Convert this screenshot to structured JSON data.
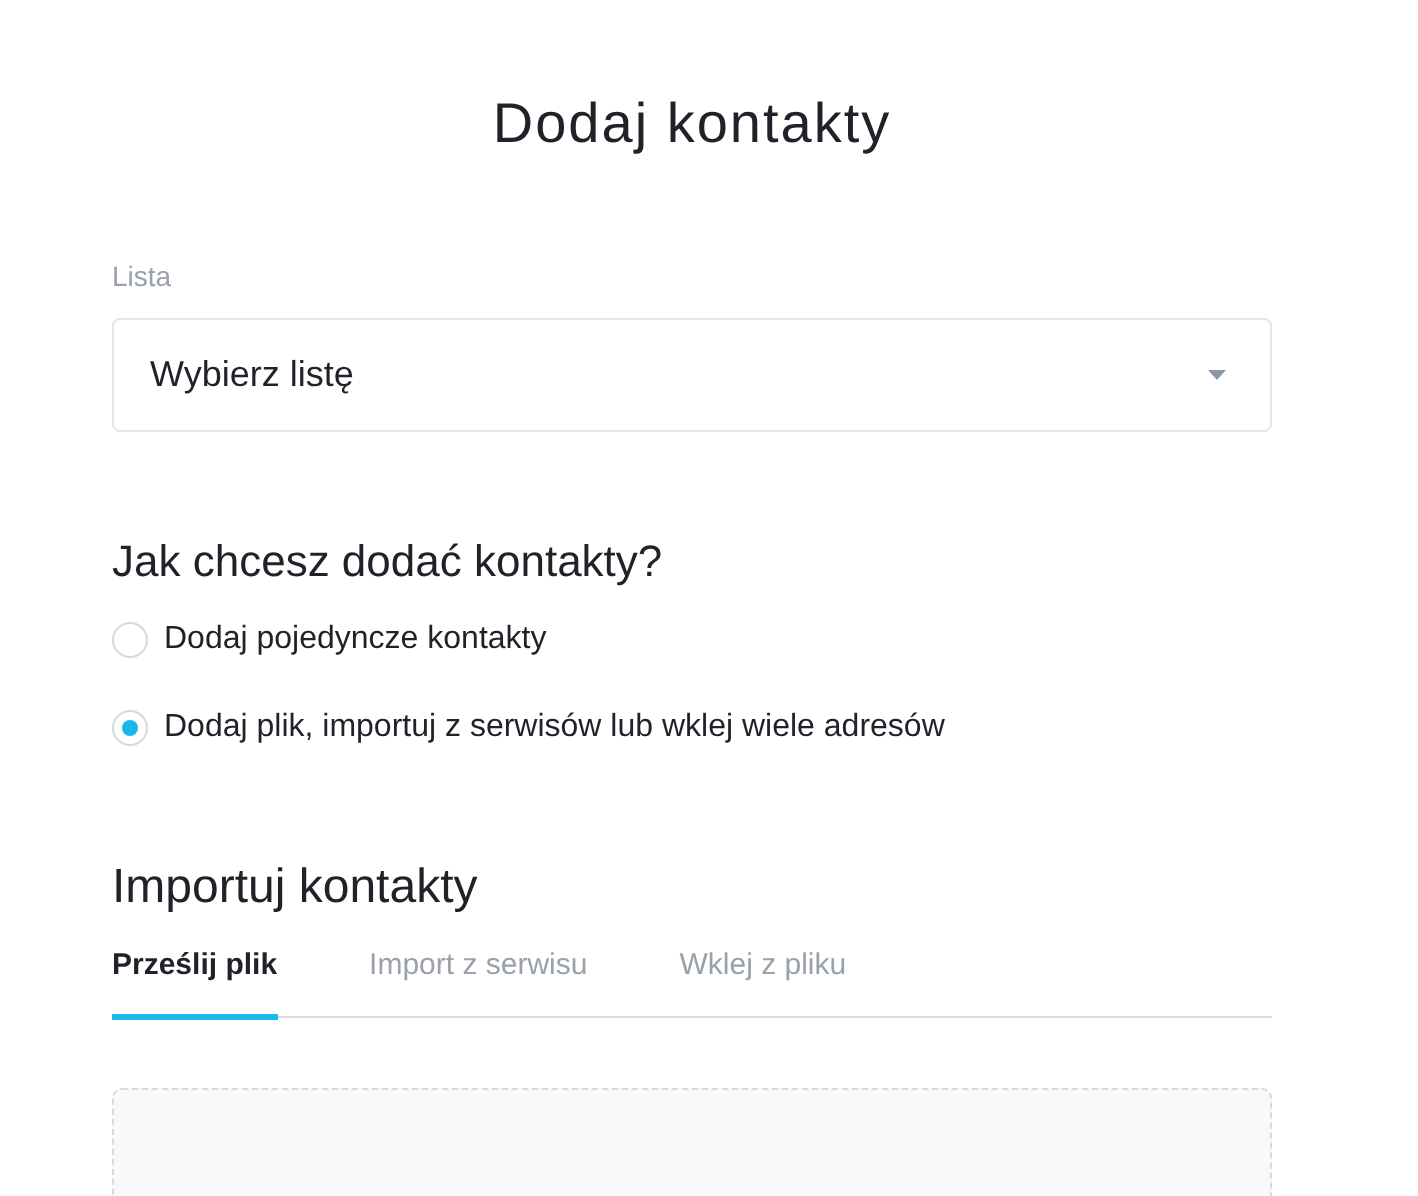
{
  "title": "Dodaj kontakty",
  "list_field": {
    "label": "Lista",
    "placeholder": "Wybierz listę"
  },
  "method": {
    "heading": "Jak chcesz dodać kontakty?",
    "options": [
      {
        "label": "Dodaj pojedyncze kontakty",
        "selected": false
      },
      {
        "label": "Dodaj plik, importuj z serwisów lub wklej wiele adresów",
        "selected": true
      }
    ]
  },
  "import": {
    "heading": "Importuj kontakty",
    "tabs": [
      {
        "label": "Prześlij plik",
        "selected": true
      },
      {
        "label": "Import z serwisu",
        "selected": false
      },
      {
        "label": "Wklej z pliku",
        "selected": false
      }
    ]
  }
}
